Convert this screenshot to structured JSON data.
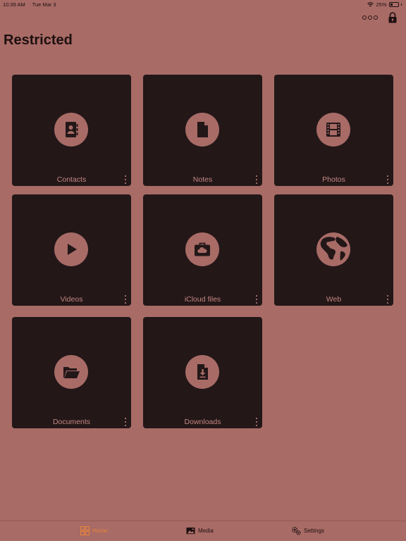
{
  "status": {
    "time": "10:39 AM",
    "date": "Tue Mar 3",
    "battery": "25%"
  },
  "header": {
    "title": "Restricted",
    "more_icon": "more-circles-icon",
    "lock_icon": "lock-icon"
  },
  "tiles": [
    {
      "label": "Contacts",
      "icon": "contacts-book-icon"
    },
    {
      "label": "Notes",
      "icon": "note-document-icon"
    },
    {
      "label": "Photos",
      "icon": "film-strip-icon"
    },
    {
      "label": "Videos",
      "icon": "play-icon"
    },
    {
      "label": "iCloud files",
      "icon": "cloud-briefcase-icon"
    },
    {
      "label": "Web",
      "icon": "globe-icon"
    },
    {
      "label": "Documents",
      "icon": "folder-icon"
    },
    {
      "label": "Downloads",
      "icon": "download-file-icon"
    }
  ],
  "tabs": [
    {
      "label": "Home",
      "icon": "grid-icon",
      "active": true
    },
    {
      "label": "Media",
      "icon": "image-icon",
      "active": false
    },
    {
      "label": "Settings",
      "icon": "gears-icon",
      "active": false
    }
  ],
  "colors": {
    "background": "#a86b66",
    "tile": "#231718",
    "accent": "#e8843a",
    "label": "#c48782"
  }
}
